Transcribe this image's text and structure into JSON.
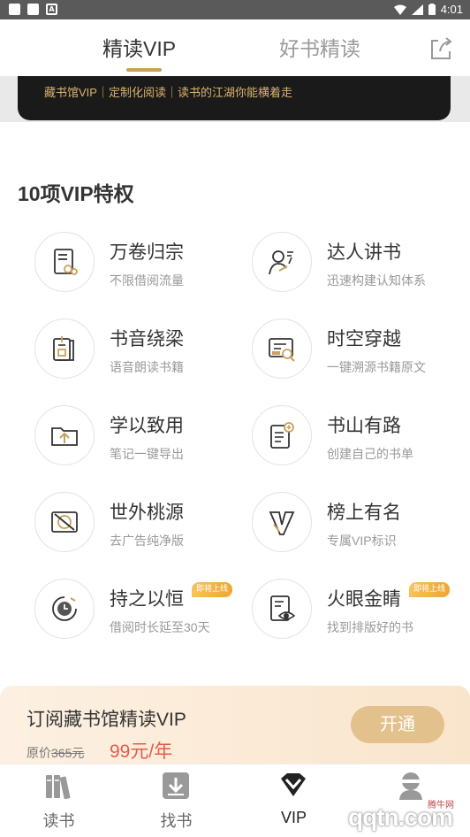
{
  "status_bar": {
    "time": "4:01"
  },
  "tabs": {
    "active": "精读VIP",
    "inactive": "好书精读"
  },
  "banner": {
    "text": "藏书馆VIP｜定制化阅读｜读书的江湖你能横着走"
  },
  "section_title": "10项VIP特权",
  "privileges": [
    {
      "title": "万卷归宗",
      "desc": "不限借阅流量",
      "icon": "book-stack-icon",
      "badge": ""
    },
    {
      "title": "达人讲书",
      "desc": "迅速构建认知体系",
      "icon": "lecturer-icon",
      "badge": ""
    },
    {
      "title": "书音绕梁",
      "desc": "语音朗读书籍",
      "icon": "audio-book-icon",
      "badge": ""
    },
    {
      "title": "时空穿越",
      "desc": "一键溯源书籍原文",
      "icon": "search-document-icon",
      "badge": ""
    },
    {
      "title": "学以致用",
      "desc": "笔记一键导出",
      "icon": "folder-export-icon",
      "badge": ""
    },
    {
      "title": "书山有路",
      "desc": "创建自己的书单",
      "icon": "booklist-add-icon",
      "badge": ""
    },
    {
      "title": "世外桃源",
      "desc": "去广告纯净版",
      "icon": "no-ads-icon",
      "badge": ""
    },
    {
      "title": "榜上有名",
      "desc": "专属VIP标识",
      "icon": "vip-badge-icon",
      "badge": ""
    },
    {
      "title": "持之以恒",
      "desc": "借阅时长延至30天",
      "icon": "clock-icon",
      "badge": "即将上线"
    },
    {
      "title": "火眼金睛",
      "desc": "找到排版好的书",
      "icon": "eye-document-icon",
      "badge": "即将上线"
    }
  ],
  "subscription": {
    "title": "订阅藏书馆精读VIP",
    "orig_label": "原价",
    "orig_price": "365元",
    "price": "99元/年",
    "button": "开通"
  },
  "bottom_nav": [
    {
      "label": "读书",
      "icon": "bookshelf-icon"
    },
    {
      "label": "找书",
      "icon": "find-book-icon"
    },
    {
      "label": "VIP",
      "icon": "diamond-icon"
    },
    {
      "label": "",
      "icon": "profile-icon"
    }
  ],
  "watermark": {
    "text": "腾牛网",
    "logo": "qqtn.com"
  },
  "colors": {
    "gold": "#c9a05c",
    "price_red": "#e8594a",
    "badge": "#f0ad3a",
    "banner_text": "#d9b36c"
  }
}
